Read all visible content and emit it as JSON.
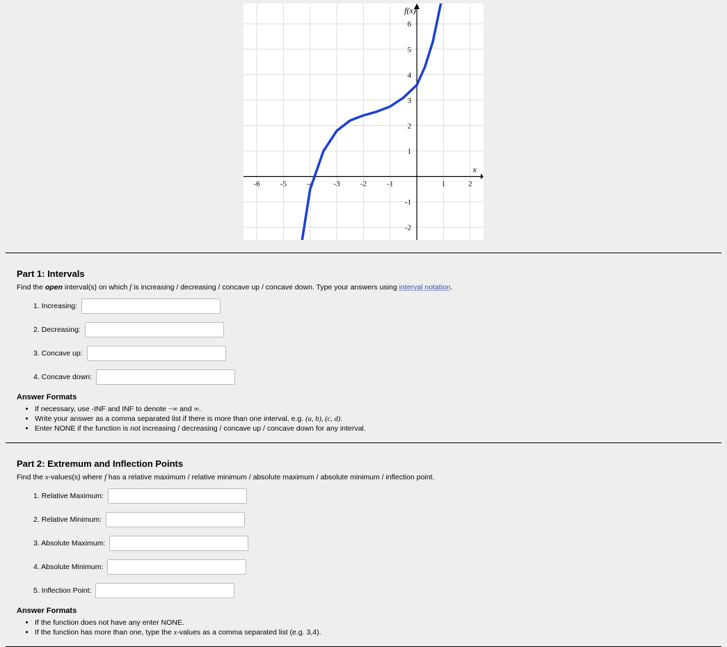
{
  "chart_data": {
    "type": "line",
    "title": "f(x)",
    "xlabel": "x",
    "ylabel": "",
    "xlim": [
      -6.5,
      2.5
    ],
    "ylim": [
      -2.5,
      6.8
    ],
    "xticks": [
      -6,
      -5,
      -4,
      -3,
      -2,
      -1,
      1,
      2
    ],
    "yticks": [
      -2,
      -1,
      1,
      2,
      3,
      4,
      5,
      6
    ],
    "series": [
      {
        "name": "f",
        "x": [
          -4.3,
          -4.0,
          -3.5,
          -3.0,
          -2.5,
          -2.0,
          -1.5,
          -1.0,
          -0.5,
          0.0,
          0.3,
          0.6,
          0.9
        ],
        "y": [
          -2.5,
          -0.5,
          1.0,
          1.8,
          2.2,
          2.4,
          2.55,
          2.75,
          3.1,
          3.6,
          4.3,
          5.3,
          6.8
        ]
      }
    ]
  },
  "part1": {
    "heading": "Part 1: Intervals",
    "instruction_prefix": "Find the ",
    "instruction_open": "open",
    "instruction_mid": " interval(s) on which ",
    "instruction_f": "f",
    "instruction_suffix": " is increasing / decreasing / concave up / concave down. Type your answers using ",
    "link_text": "interval notation",
    "instruction_end": ".",
    "fields": [
      {
        "num": "1.",
        "label": "Increasing:"
      },
      {
        "num": "2.",
        "label": "Decreasing:"
      },
      {
        "num": "3.",
        "label": "Concave up:"
      },
      {
        "num": "4.",
        "label": "Concave down:"
      }
    ],
    "answer_formats_heading": "Answer Formats",
    "bullets": {
      "b1_a": "If necessary, use -INF and INF to denote ",
      "b1_b": "−∞",
      "b1_c": " and ",
      "b1_d": "∞",
      "b1_e": ".",
      "b2_a": "Write your answer as a comma separated list if there is more than one interval, e.g. ",
      "b2_b": "(a, b), (c, d)",
      "b2_c": ".",
      "b3": "Enter NONE if the function is not increasing / decreasing / concave up / concave down for any interval."
    }
  },
  "part2": {
    "heading": "Part 2: Extremum and Inflection Points",
    "instruction_prefix": "Find the ",
    "instruction_x": "x",
    "instruction_mid": "-values(s) where ",
    "instruction_f": "f",
    "instruction_suffix": " has a relative maximum / relative minimum / absolute maximum / absolute minimum / inflection point.",
    "fields": [
      {
        "num": "1.",
        "label": "Relative Maximum:"
      },
      {
        "num": "2.",
        "label": "Relative Minimum:"
      },
      {
        "num": "3.",
        "label": "Absolute Maximum:"
      },
      {
        "num": "4.",
        "label": "Absolute Minimum:"
      },
      {
        "num": "5.",
        "label": "Inflection Point:"
      }
    ],
    "answer_formats_heading": "Answer Formats",
    "bullets": {
      "b1": "If the function does not have any enter NONE.",
      "b2_a": "If the function has more than one, type the ",
      "b2_b": "x",
      "b2_c": "-values as a comma separated list (e.g. 3,4)."
    }
  }
}
